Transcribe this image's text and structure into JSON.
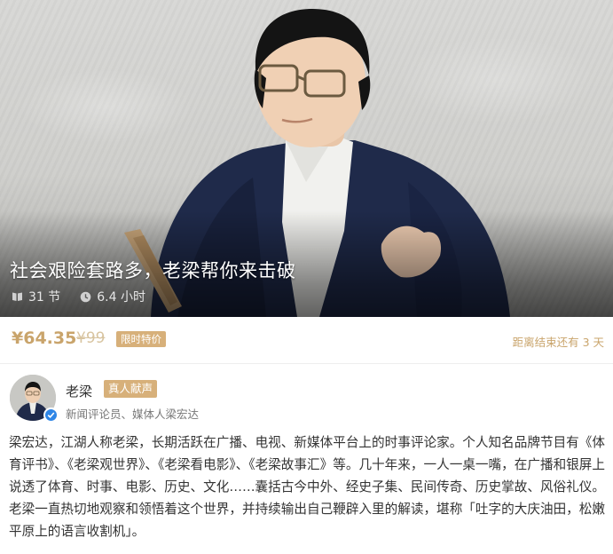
{
  "hero": {
    "title": "社会艰险套路多，老梁帮你来击破",
    "lessons": "31 节",
    "duration": "6.4 小时",
    "lessons_icon": "book-icon",
    "duration_icon": "clock-icon"
  },
  "price": {
    "current": "¥64.35",
    "original": "¥99",
    "badge": "限时特价",
    "countdown": "距离结束还有 3 天",
    "accent_color": "#c9a46b"
  },
  "author": {
    "name": "老梁",
    "badge": "真人献声",
    "title": "新闻评论员、媒体人梁宏达",
    "verified_icon": "verified-check-icon"
  },
  "description": "梁宏达，江湖人称老梁，长期活跃在广播、电视、新媒体平台上的时事评论家。个人知名品牌节目有《体育评书》、《老梁观世界》、《老梁看电影》、《老梁故事汇》等。几十年来，一人一桌一嘴，在广播和银屏上说透了体育、时事、电影、历史、文化……囊括古今中外、经史子集、民间传奇、历史掌故、风俗礼仪。 老梁一直热切地观察和领悟着这个世界，并持续输出自己鞭辟入里的解读，堪称「吐字的大庆油田，松嫩平原上的语言收割机」。"
}
